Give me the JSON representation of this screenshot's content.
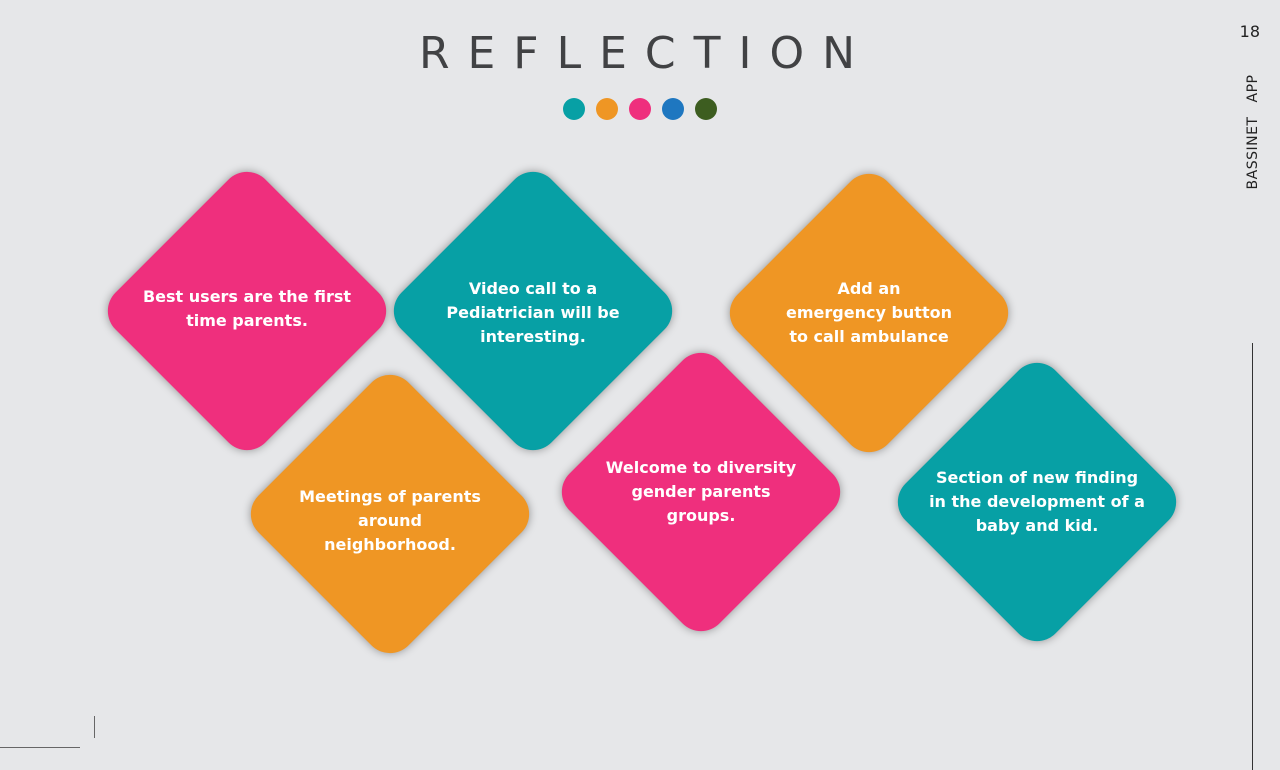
{
  "slide": {
    "title": "REFLECTION",
    "page_number": "18",
    "side_label_1": "BASSINET",
    "side_label_2": "APP"
  },
  "dots": [
    "#07a0a5",
    "#ef9624",
    "#ef2f7d",
    "#1e77c0",
    "#3d5d20"
  ],
  "colors": {
    "pink": "#ef2f7d",
    "teal": "#07a0a5",
    "orange": "#ef9624",
    "title_text": "#414244",
    "background": "#e6e7e9"
  },
  "cards": [
    {
      "text": "Best users are the first time parents.",
      "color": "pink"
    },
    {
      "text": "Video call to a Pediatrician will be interesting.",
      "color": "teal"
    },
    {
      "text": "Add an emergency button to call ambulance",
      "color": "orange"
    },
    {
      "text": "Meetings of parents around neighborhood.",
      "color": "orange"
    },
    {
      "text": "Welcome to diversity gender parents groups.",
      "color": "pink"
    },
    {
      "text": "Section of new finding in the development of a baby and kid.",
      "color": "teal"
    }
  ]
}
